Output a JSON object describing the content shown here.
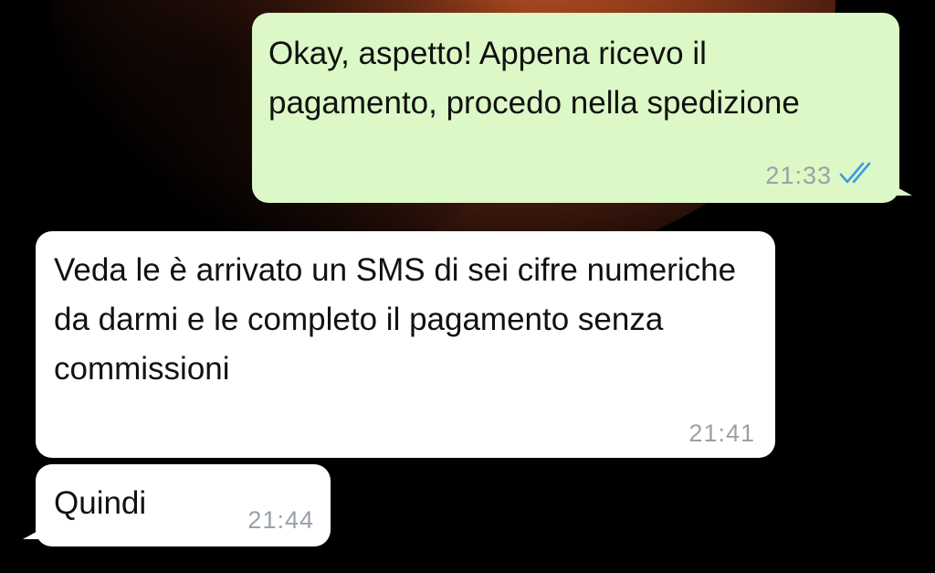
{
  "chat": {
    "messages": [
      {
        "direction": "outgoing",
        "text": "Okay, aspetto! Appena ricevo il pagamento, procedo nella spedizione",
        "time": "21:33",
        "status_icon": "double-check-read-icon",
        "status_color": "#3d9be9"
      },
      {
        "direction": "incoming",
        "text": "Veda le è arrivato un SMS di sei cifre numeriche da darmi e le completo il pagamento senza commissioni",
        "time": "21:41"
      },
      {
        "direction": "incoming",
        "text": "Quindi",
        "time": "21:44"
      }
    ]
  },
  "colors": {
    "outgoing_bubble": "#dcf8c6",
    "incoming_bubble": "#ffffff",
    "timestamp": "#9aa1a8",
    "background": "#000000"
  }
}
